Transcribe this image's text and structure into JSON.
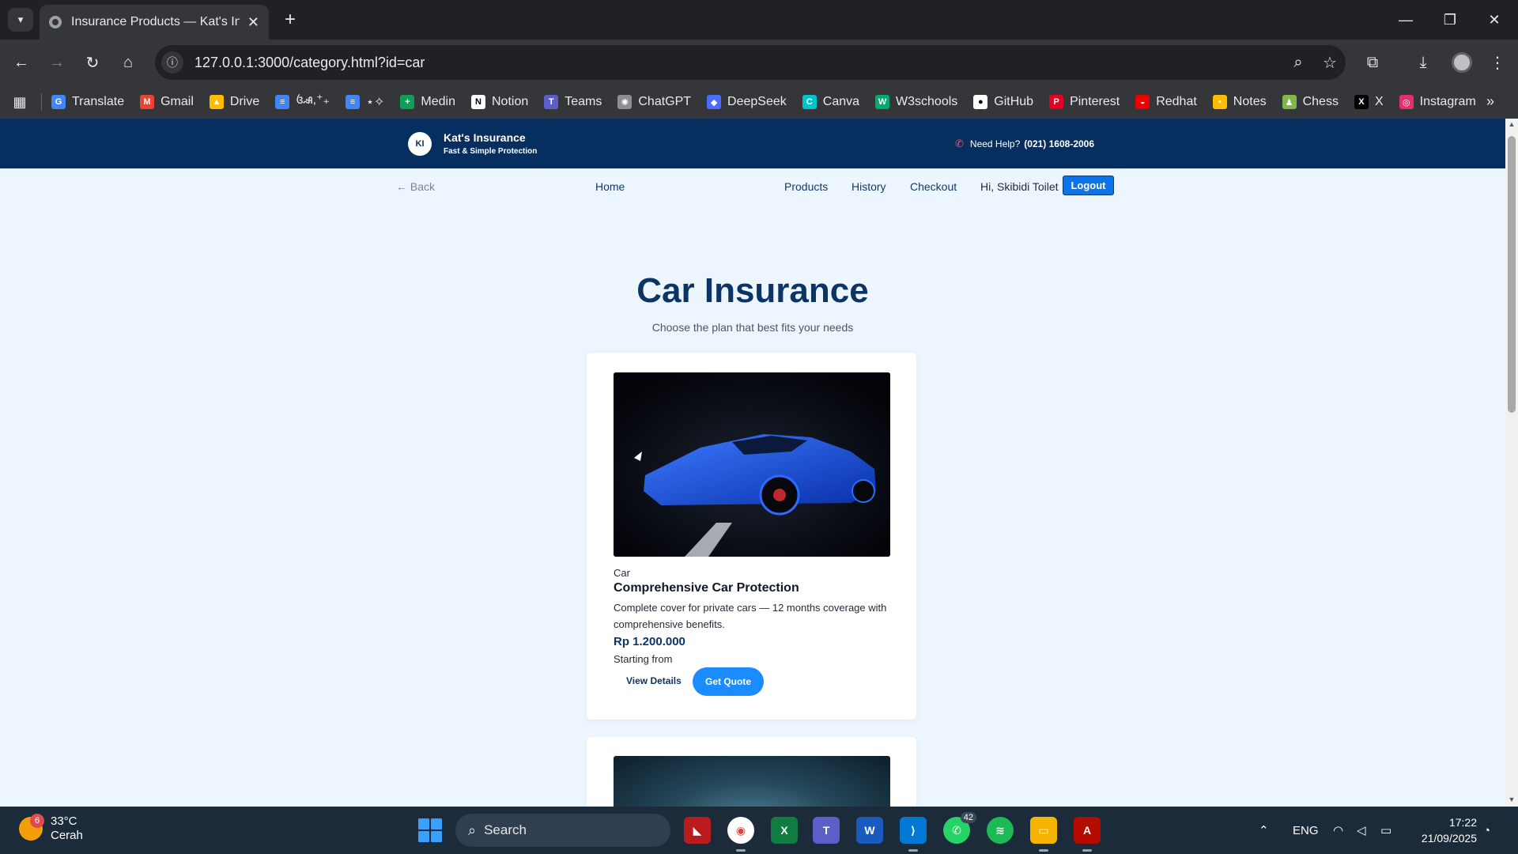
{
  "browser": {
    "tab_title": "Insurance Products — Kat's Insu",
    "url": "127.0.0.1:3000/category.html?id=car",
    "bookmarks": [
      {
        "label": "Translate",
        "color": "#4285f4",
        "glyph": "G"
      },
      {
        "label": "Gmail",
        "color": "#ea4335",
        "glyph": "M"
      },
      {
        "label": "Drive",
        "color": "#fbbc04",
        "glyph": "▲"
      },
      {
        "label": "ꦄ,⁺₊",
        "color": "#4285f4",
        "glyph": "≡"
      },
      {
        "label": "⋆✧",
        "color": "#4285f4",
        "glyph": "≡"
      },
      {
        "label": "Medin",
        "color": "#0f9d58",
        "glyph": "+"
      },
      {
        "label": "Notion",
        "color": "#ffffff",
        "glyph": "N"
      },
      {
        "label": "Teams",
        "color": "#5b5fc7",
        "glyph": "T"
      },
      {
        "label": "ChatGPT",
        "color": "#8e8e93",
        "glyph": "✺"
      },
      {
        "label": "DeepSeek",
        "color": "#4d6bfe",
        "glyph": "◆"
      },
      {
        "label": "Canva",
        "color": "#00c4cc",
        "glyph": "C"
      },
      {
        "label": "W3schools",
        "color": "#04aa6d",
        "glyph": "W"
      },
      {
        "label": "GitHub",
        "color": "#ffffff",
        "glyph": "●"
      },
      {
        "label": "Pinterest",
        "color": "#e60023",
        "glyph": "P"
      },
      {
        "label": "Redhat",
        "color": "#ee0000",
        "glyph": "◒"
      },
      {
        "label": "Notes",
        "color": "#fbbc04",
        "glyph": "▪"
      },
      {
        "label": "Chess",
        "color": "#81b64c",
        "glyph": "♟"
      },
      {
        "label": "X",
        "color": "#000000",
        "glyph": "X"
      },
      {
        "label": "Instagram",
        "color": "#e1306c",
        "glyph": "◎"
      }
    ]
  },
  "site": {
    "logo_text": "KI",
    "name": "Kat's Insurance",
    "tagline": "Fast & Simple Protection",
    "help_label": "Need Help?",
    "help_phone": "(021) 1608-2006"
  },
  "nav": {
    "back": "← Back",
    "home": "Home",
    "products": "Products",
    "history": "History",
    "checkout": "Checkout",
    "greeting": "Hi, Skibidi Toilet",
    "logout": "Logout"
  },
  "main": {
    "title": "Car Insurance",
    "subtitle": "Choose the plan that best fits your needs",
    "products": [
      {
        "category": "Car",
        "name": "Comprehensive Car Protection",
        "description": "Complete cover for private cars — 12 months coverage with comprehensive benefits.",
        "price": "Rp 1.200.000",
        "price_note": "Starting from",
        "view_label": "View Details",
        "quote_label": "Get Quote"
      }
    ]
  },
  "taskbar": {
    "temperature": "33°C",
    "condition": "Cerah",
    "weather_badge": "6",
    "search_placeholder": "Search",
    "whatsapp_count": "42",
    "language": "ENG",
    "time": "17:22",
    "date": "21/09/2025"
  }
}
